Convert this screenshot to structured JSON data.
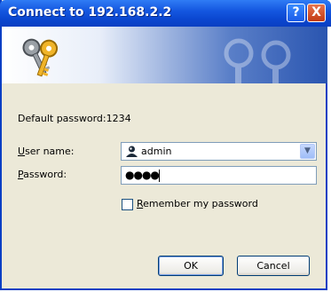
{
  "window": {
    "title": "Connect to 192.168.2.2",
    "help_icon": "?",
    "close_icon": "X"
  },
  "hint": {
    "default_password": "Default password:1234"
  },
  "form": {
    "username_label_accel": "U",
    "username_label_rest": "ser name:",
    "username_value": "admin",
    "password_label_accel": "P",
    "password_label_rest": "assword:",
    "password_masked": "●●●●",
    "remember_accel": "R",
    "remember_rest": "emember my password",
    "remember_checked": false
  },
  "buttons": {
    "ok_label": "OK",
    "cancel_label": "Cancel"
  },
  "icons": {
    "banner": "keys-icon",
    "user": "user-account-icon",
    "dropdown": "chevron-down-icon"
  }
}
